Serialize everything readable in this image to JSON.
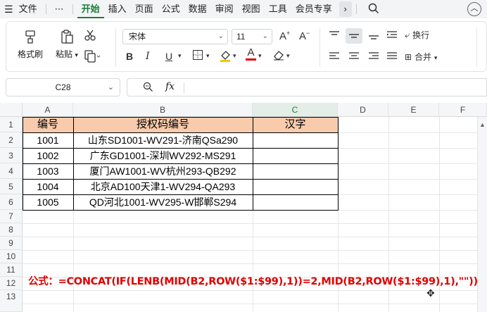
{
  "menu": {
    "hamburger": "☰",
    "file": "文件",
    "more": "⋯",
    "tabs": [
      "开始",
      "插入",
      "页面",
      "公式",
      "数据",
      "审阅",
      "视图",
      "工具",
      "会员专享"
    ],
    "overflow": "›"
  },
  "ribbon": {
    "format_painter": "格式刷",
    "paste": "粘贴",
    "font_name": "宋体",
    "font_size": "11",
    "wrap": "换行",
    "merge": "合并"
  },
  "formula_bar": {
    "cell_ref": "C28",
    "fx": "fx",
    "value": ""
  },
  "sheet": {
    "columns": [
      "A",
      "B",
      "C",
      "D",
      "E",
      "F"
    ],
    "rows": [
      "1",
      "2",
      "3",
      "4",
      "5",
      "6",
      "7",
      "8",
      "9",
      "10",
      "11",
      "12",
      "13"
    ],
    "header": [
      "编号",
      "授权码编号",
      "汉字"
    ],
    "data": [
      [
        "1001",
        "山东SD1001-WV291-济南QSa290",
        ""
      ],
      [
        "1002",
        "广东GD1001-深圳WV292-MS291",
        ""
      ],
      [
        "1003",
        "厦门AW1001-WV杭州293-QB292",
        ""
      ],
      [
        "1004",
        "北京AD100天津1-WV294-QA293",
        ""
      ],
      [
        "1005",
        "QD河北1001-WV295-W邯郸S294",
        ""
      ]
    ],
    "formula_note": "公式：=CONCAT(IF(LENB(MID(B2,ROW($1:$99),1))=2,MID(B2,ROW($1:$99),1),\"\"))"
  },
  "colors": {
    "accent": "#1a7f37",
    "header_fill": "#f8cbad",
    "formula_text": "#e00000"
  }
}
